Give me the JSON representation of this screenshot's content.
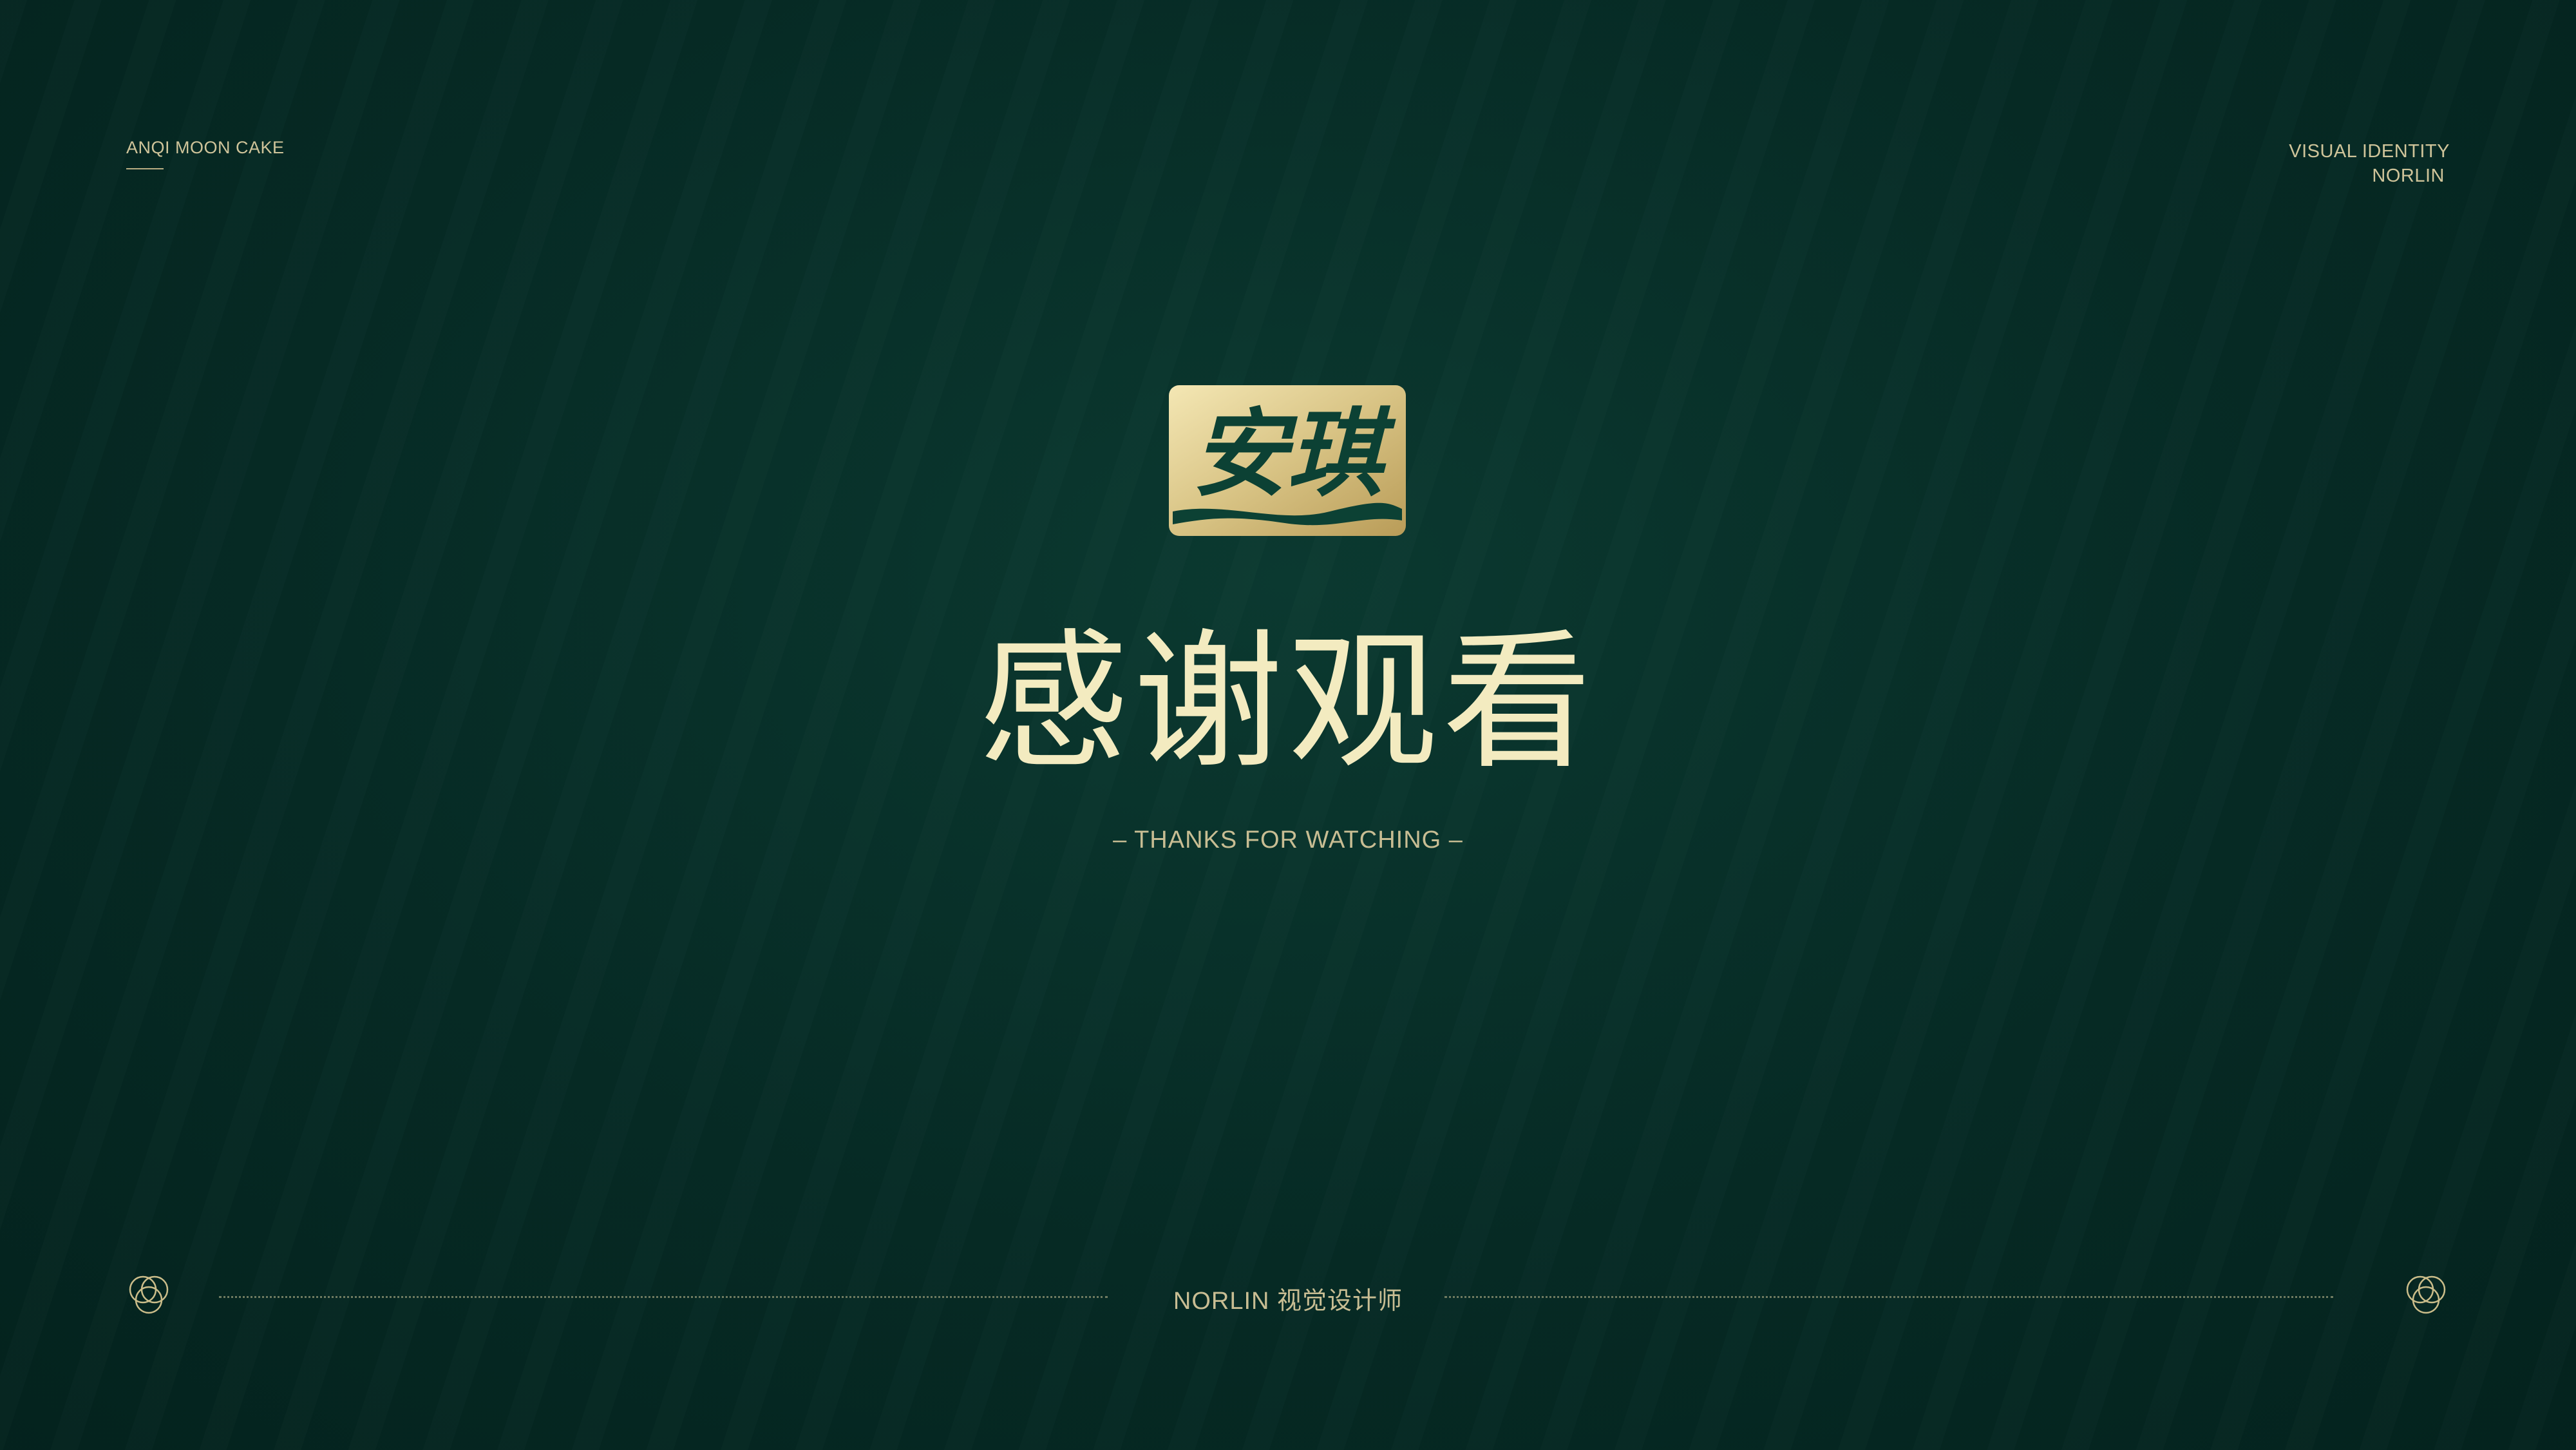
{
  "header": {
    "left_text": "ANQI MOON CAKE",
    "right_line1": "VISUAL IDENTITY",
    "right_line2": "NORLIN"
  },
  "logo": {
    "icon": "anqi-brand-logo",
    "text": "安琪"
  },
  "main": {
    "title": "感谢观看",
    "subtitle": "– THANKS FOR WATCHING –"
  },
  "footer": {
    "text": "NORLIN 视觉设计师",
    "left_icon": "rings-icon",
    "right_icon": "rings-icon"
  },
  "colors": {
    "background": "#062b25",
    "gold": "#d9cfa6",
    "title": "#f3ebc0"
  }
}
